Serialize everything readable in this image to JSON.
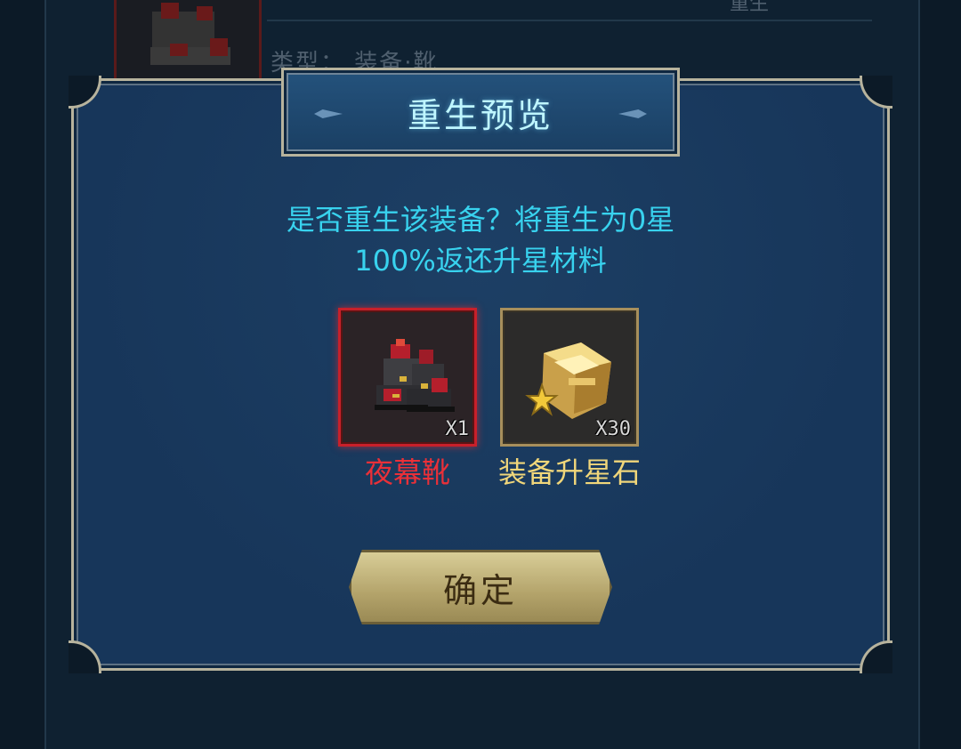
{
  "background": {
    "type_label": "类型： 装备·靴",
    "rebirth_tag": "重生"
  },
  "dialog": {
    "title": "重生预览",
    "message_line1": "是否重生该装备？将重生为0星",
    "message_line2": "100%返还升星材料",
    "items": [
      {
        "name": "夜幕靴",
        "quantity": "X1",
        "icon": "boots-icon",
        "rarity_color": "#ea3038"
      },
      {
        "name": "装备升星石",
        "quantity": "X30",
        "icon": "star-stone-icon",
        "rarity_color": "#f0d67a"
      }
    ],
    "confirm_label": "确定"
  }
}
